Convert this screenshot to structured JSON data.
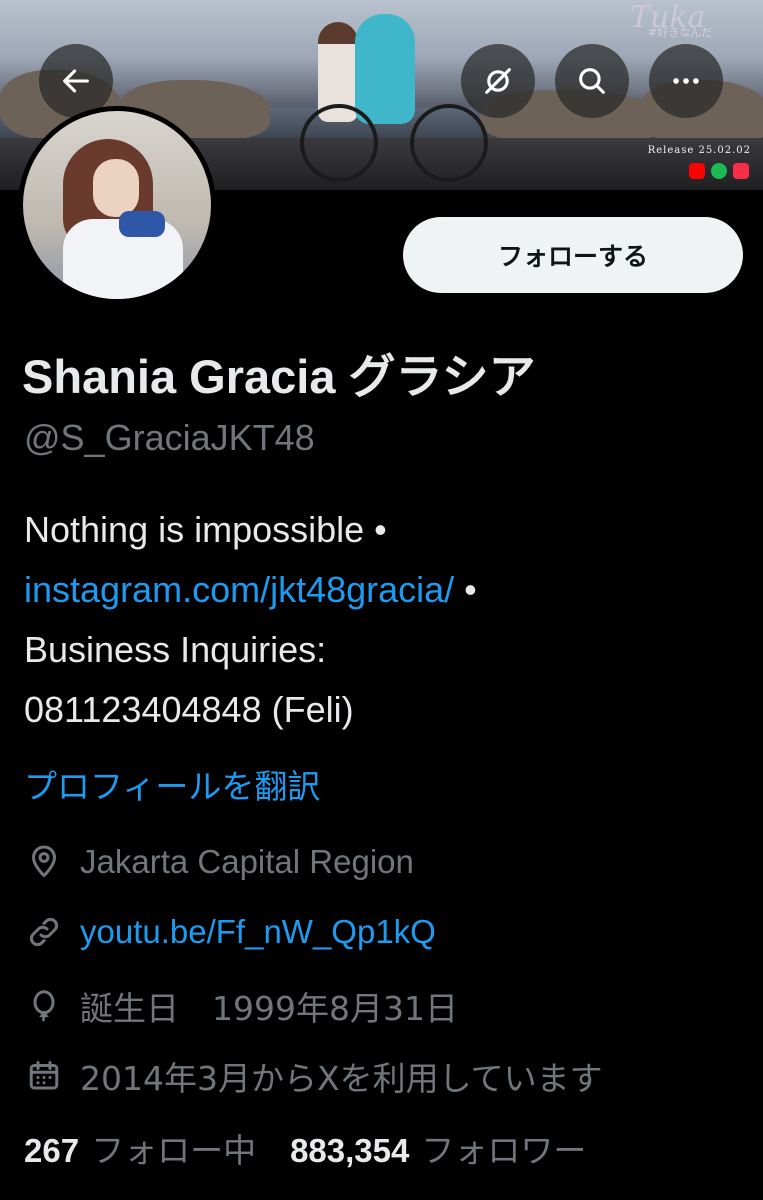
{
  "banner": {
    "brand": "Tuka",
    "brand_sub": "#好きなんだ",
    "release": "Release 25.02.02",
    "platform_colors": [
      "#ff0000",
      "#1db954",
      "#fa2d48"
    ]
  },
  "header_buttons": {
    "back": "back-arrow-icon",
    "grok": "slash-circle-icon",
    "search": "search-icon",
    "more": "more-icon"
  },
  "profile": {
    "follow_label": "フォローする",
    "name": "Shania Gracia グラシア",
    "handle": "@S_GraciaJKT48",
    "bio": {
      "line1": "Nothing is impossible •",
      "link": "instagram.com/jkt48gracia/",
      "link_suffix": " •",
      "line3": "Business Inquiries:",
      "line4": "081123404848 (Feli)"
    },
    "translate_label": "プロフィールを翻訳",
    "location": "Jakarta Capital Region",
    "website": "youtu.be/Ff_nW_Qp1kQ",
    "birthday": "誕生日　1999年8月31日",
    "joined": "2014年3月からXを利用しています",
    "following_count": "267",
    "following_label": "フォロー中",
    "followers_count": "883,354",
    "followers_label": "フォロワー"
  },
  "colors": {
    "background": "#000000",
    "link": "#1d9bf0",
    "muted": "#71767b",
    "text": "#e7e9ea"
  }
}
